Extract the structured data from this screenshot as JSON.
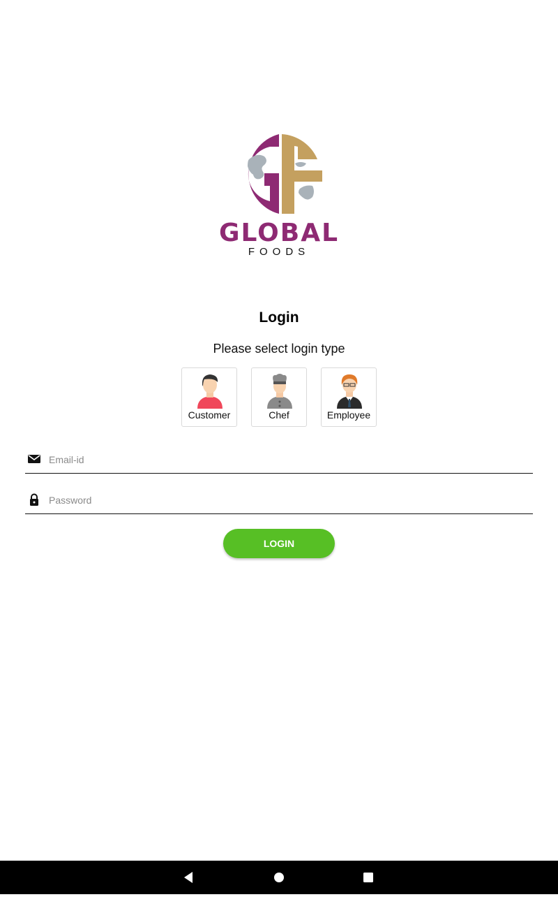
{
  "brand": {
    "name": "GLOBAL",
    "tagline": "FOODS",
    "logo_letters": "GF",
    "primary_color": "#8e2a73",
    "secondary_color": "#c4a05f"
  },
  "login": {
    "title": "Login",
    "subtitle": "Please select login type",
    "types": [
      {
        "label": "Customer",
        "icon": "customer-avatar-icon"
      },
      {
        "label": "Chef",
        "icon": "chef-avatar-icon"
      },
      {
        "label": "Employee",
        "icon": "employee-avatar-icon"
      }
    ],
    "email": {
      "placeholder": "Email-id",
      "value": "",
      "icon": "envelope-icon"
    },
    "password": {
      "placeholder": "Password",
      "value": "",
      "icon": "lock-icon"
    },
    "button_label": "LOGIN",
    "button_color": "#57bf25"
  },
  "navbar": {
    "buttons": [
      "back",
      "home",
      "recents"
    ]
  }
}
